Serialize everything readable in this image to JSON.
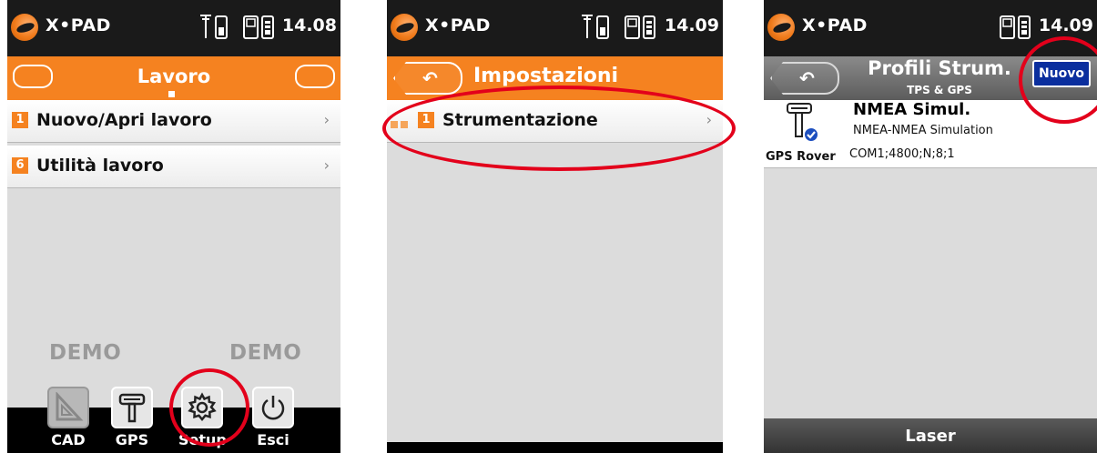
{
  "status": {
    "app_name": "X•PAD",
    "icons": [
      "antenna-icon",
      "battery-icon",
      "device-battery-icon"
    ]
  },
  "screens": [
    {
      "time": "14.08",
      "title": "Lavoro",
      "menu": [
        {
          "badge": "1",
          "label": "Nuovo/Apri lavoro"
        },
        {
          "badge": "6",
          "label": "Utilità lavoro"
        }
      ],
      "demo_left": "DEMO",
      "demo_right": "DEMO",
      "toolbar": [
        {
          "label": "CAD",
          "icon": "set-square-icon"
        },
        {
          "label": "GPS",
          "icon": "gps-receiver-icon"
        },
        {
          "label": "Setup",
          "icon": "gear-icon"
        },
        {
          "label": "Esci",
          "icon": "power-icon"
        }
      ]
    },
    {
      "time": "14.09",
      "title": "Impostazioni",
      "menu": [
        {
          "badge": "1",
          "label": "Strumentazione"
        }
      ]
    },
    {
      "time": "14.09",
      "title": "Profili Strum.",
      "subtitle": "TPS & GPS",
      "new_button": "Nuovo",
      "profile": {
        "name": "NMEA Simul.",
        "description": "NMEA-NMEA Simulation",
        "connection": "COM1;4800;N;8;1",
        "type": "GPS Rover"
      },
      "bottom_label": "Laser"
    }
  ],
  "colors": {
    "accent": "#f58220",
    "highlight_ring": "#e3001b",
    "new_button": "#0a2e9e"
  }
}
